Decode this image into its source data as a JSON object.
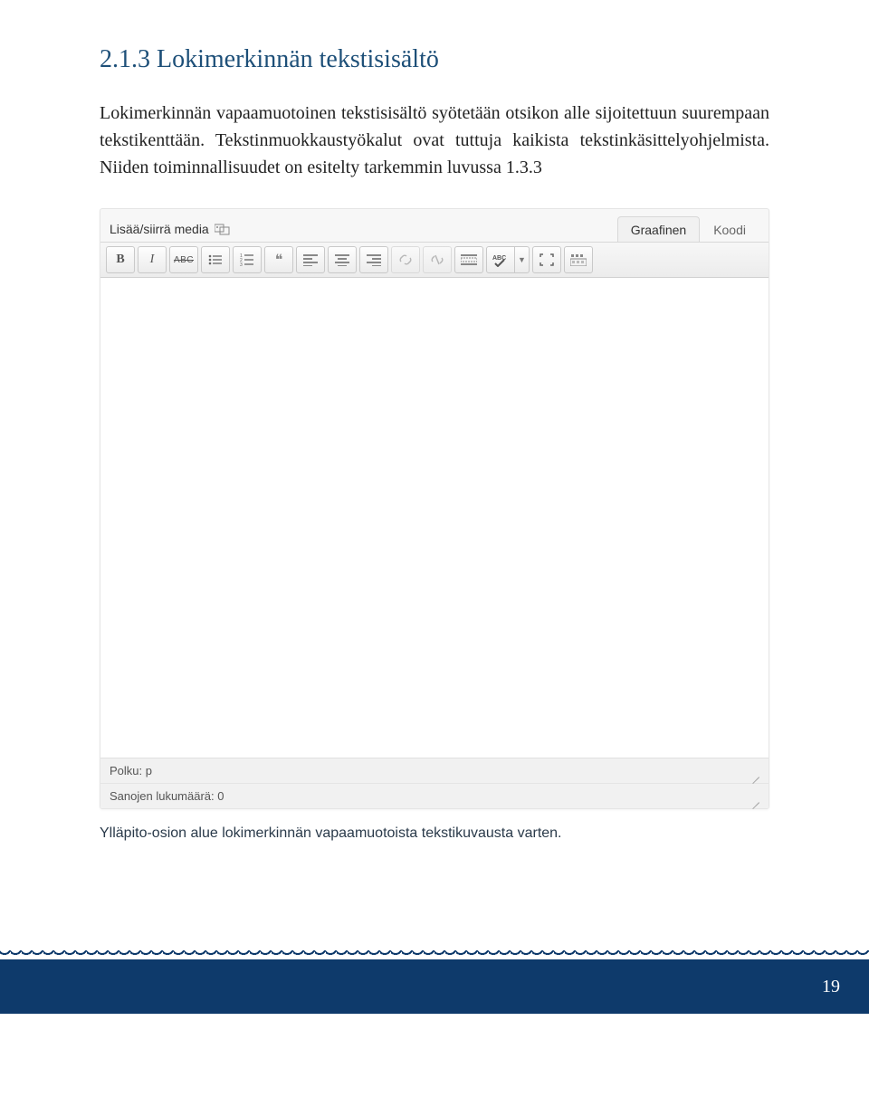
{
  "heading": "2.1.3 Lokimerkinnän tekstisisältö",
  "paragraph": "Lokimerkinnän vapaamuotoinen tekstisisältö syötetään otsikon alle sijoitettuun suurempaan tekstikenttään. Tekstinmuokkaustyökalut ovat tuttuja kaikista tekstinkäsittelyohjelmista. Niiden toiminnallisuudet on esitelty tarkemmin luvussa 1.3.3",
  "editor": {
    "mediaLabel": "Lisää/siirrä media",
    "tabs": {
      "visual": "Graafinen",
      "code": "Koodi"
    },
    "toolbar": {
      "bold": "B",
      "italic": "I",
      "strike": "ABC",
      "quote": "❝",
      "spell": "ABC"
    },
    "status": {
      "path": "Polku: p",
      "wordCount": "Sanojen lukumäärä: 0"
    }
  },
  "caption": "Ylläpito-osion alue lokimerkinnän vapaamuotoista tekstikuvausta varten.",
  "pageNumber": "19"
}
